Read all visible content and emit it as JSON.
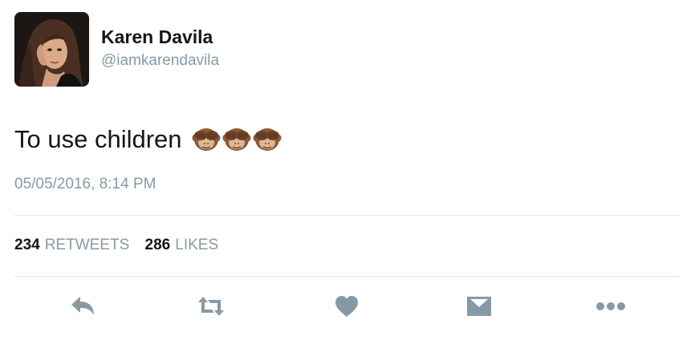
{
  "user": {
    "name": "Karen Davila",
    "handle": "@iamkarendavila"
  },
  "tweet": {
    "text": "To use children",
    "emoji": [
      "see-no-evil-monkey",
      "see-no-evil-monkey",
      "see-no-evil-monkey"
    ],
    "timestamp": "05/05/2016, 8:14 PM"
  },
  "stats": {
    "retweets_count": "234",
    "retweets_label": "RETWEETS",
    "likes_count": "286",
    "likes_label": "LIKES"
  },
  "actions": [
    "reply-icon",
    "retweet-icon",
    "like-icon",
    "message-icon",
    "more-icon"
  ],
  "colors": {
    "text": "#14171a",
    "secondary": "#8899a6",
    "divider": "#e1e8ed"
  }
}
